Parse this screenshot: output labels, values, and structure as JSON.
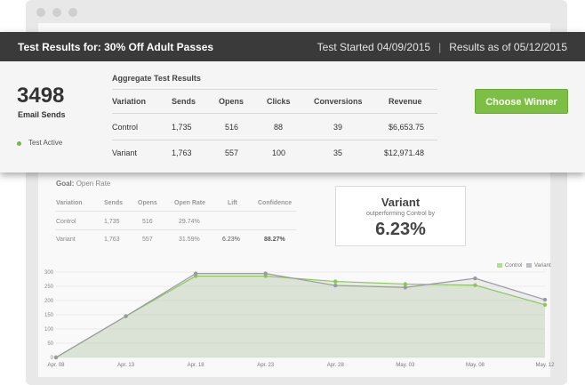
{
  "header": {
    "title": "Test Results for: 30% Off Adult Passes",
    "test_started": "Test Started 04/09/2015",
    "separator": "|",
    "results_as_of": "Results as of 05/12/2015"
  },
  "summary": {
    "sends_number": "3498",
    "sends_label": "Email Sends",
    "status": "Test Active"
  },
  "aggregate": {
    "title": "Aggregate Test Results",
    "columns": [
      "Variation",
      "Sends",
      "Opens",
      "Clicks",
      "Conversions",
      "Revenue"
    ],
    "rows": [
      [
        "Control",
        "1,735",
        "516",
        "88",
        "39",
        "$6,653.75"
      ],
      [
        "Variant",
        "1,763",
        "557",
        "100",
        "35",
        "$12,971.48"
      ]
    ]
  },
  "actions": {
    "choose_winner": "Choose Winner"
  },
  "background_report": {
    "goal_label": "Goal:",
    "goal_value": "Open Rate",
    "columns": [
      "Variation",
      "Sends",
      "Opens",
      "Open Rate",
      "Lift",
      "Confidence"
    ],
    "rows": [
      [
        "Control",
        "1,735",
        "516",
        "29.74%",
        "",
        ""
      ],
      [
        "Variant",
        "1,763",
        "557",
        "31.59%",
        "6.23%",
        "88.27%"
      ]
    ],
    "variant_card": {
      "title": "Variant",
      "subtitle": "outperforming Control by",
      "value": "6.23%"
    }
  },
  "colors": {
    "header_bg": "#3a3a3a",
    "button_green": "#7dbf45",
    "status_green": "#6abf3f",
    "control_line": "#8cc55a",
    "variant_line": "#9a9aa2"
  },
  "chart_data": {
    "type": "line",
    "categories": [
      "Apr. 08",
      "Apr. 13",
      "Apr. 18",
      "Apr. 23",
      "Apr. 28",
      "May. 03",
      "May. 08",
      "May. 12"
    ],
    "series": [
      {
        "name": "Control",
        "values": [
          0,
          145,
          286,
          286,
          267,
          258,
          254,
          185
        ]
      },
      {
        "name": "Variant",
        "values": [
          0,
          145,
          295,
          295,
          253,
          246,
          278,
          203
        ]
      }
    ],
    "yticks": [
      0,
      50,
      100,
      150,
      200,
      250,
      300
    ],
    "ylim": [
      0,
      300
    ],
    "grid": true,
    "legend_position": "top-right"
  }
}
